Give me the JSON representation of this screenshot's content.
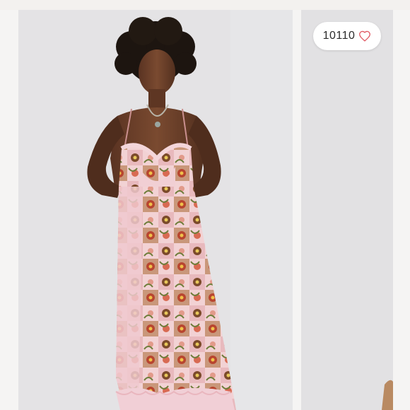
{
  "listing": {
    "likes": {
      "count": "10110",
      "icon": "heart-outline-icon",
      "icon_color": "#e05a64"
    }
  },
  "carousel": {
    "slides": [
      {
        "name": "model-wearing-floral-slip-dress-photo",
        "active": true
      },
      {
        "name": "next-product-photo-preview",
        "active": false
      }
    ]
  },
  "colors": {
    "background": "#f1efed",
    "photo_backdrop": "#e3e2e4",
    "dress_pink": "#f0c9cf"
  }
}
